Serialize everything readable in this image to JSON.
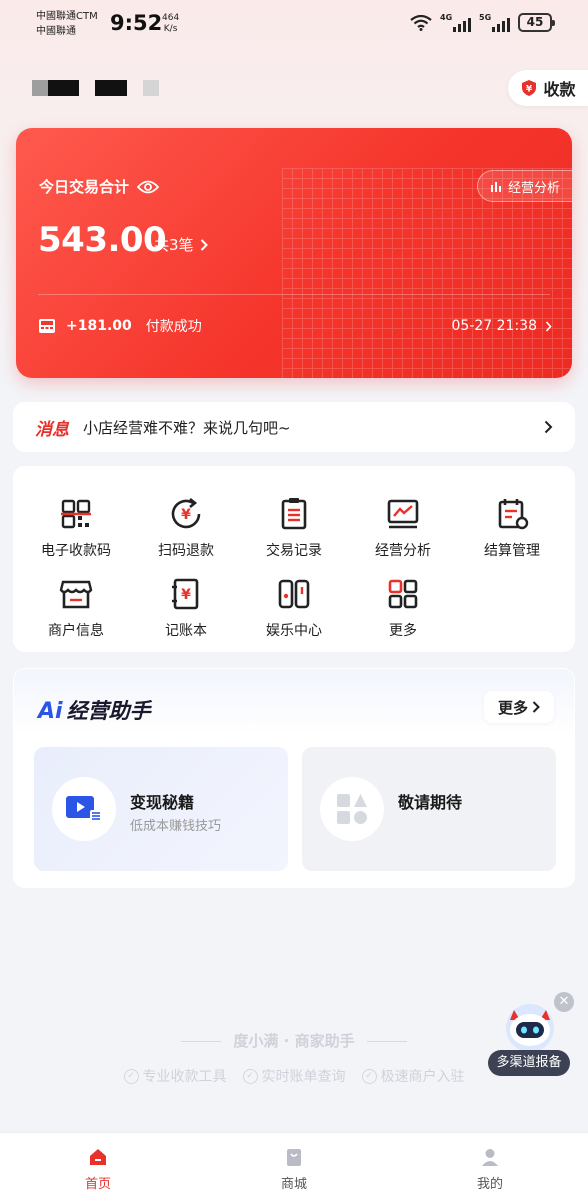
{
  "status_bar": {
    "carrier_line1": "中國聯通CTM",
    "carrier_line2": "中國聯通",
    "time": "9:52",
    "net_speed_value": "464",
    "net_speed_unit": "K/s",
    "sim1_tag": "4G",
    "sim2_tag": "5G",
    "battery": "45"
  },
  "header": {
    "collect_label": "收款"
  },
  "transaction_card": {
    "title": "今日交易合计",
    "analysis_label": "经营分析",
    "amount": "543.00",
    "count_label": "共3笔",
    "latest_amount": "+181.00",
    "latest_status": "付款成功",
    "latest_time": "05-27 21:38"
  },
  "notice": {
    "tag": "消息",
    "text": "小店经营难不难？来说几句吧~"
  },
  "menu": {
    "items": [
      {
        "label": "电子收款码",
        "icon": "qr-code-icon"
      },
      {
        "label": "扫码退款",
        "icon": "refund-icon"
      },
      {
        "label": "交易记录",
        "icon": "record-icon"
      },
      {
        "label": "经营分析",
        "icon": "chart-icon"
      },
      {
        "label": "结算管理",
        "icon": "settlement-icon"
      },
      {
        "label": "商户信息",
        "icon": "shop-icon"
      },
      {
        "label": "记账本",
        "icon": "ledger-icon"
      },
      {
        "label": "娱乐中心",
        "icon": "entertainment-icon"
      },
      {
        "label": "更多",
        "icon": "more-grid-icon"
      }
    ]
  },
  "ai_assistant": {
    "title_prefix": "Ai",
    "title": "经营助手",
    "more_label": "更多",
    "tiles": [
      {
        "title": "变现秘籍",
        "subtitle": "低成本赚钱技巧"
      },
      {
        "title": "敬请期待",
        "subtitle": ""
      }
    ]
  },
  "footer": {
    "brand": "度小满 · 商家助手",
    "features": [
      "专业收款工具",
      "实时账单查询",
      "极速商户入驻"
    ]
  },
  "float_helper": {
    "label": "多渠道报备"
  },
  "tabbar": {
    "tabs": [
      {
        "label": "首页",
        "active": true
      },
      {
        "label": "商城",
        "active": false
      },
      {
        "label": "我的",
        "active": false
      }
    ]
  },
  "colors": {
    "brand_red": "#f5352c",
    "ai_blue": "#2b55e6",
    "text_dark": "#1f1f1f",
    "muted": "#999999"
  }
}
